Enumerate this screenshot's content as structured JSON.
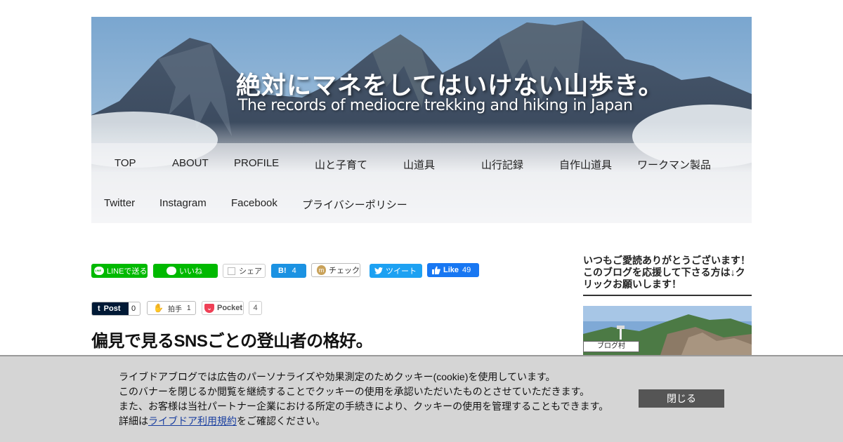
{
  "header": {
    "title": "絶対にマネをしてはいけない山歩き。",
    "subtitle": "The records of mediocre trekking and hiking in Japan"
  },
  "nav": {
    "row1": [
      "TOP",
      "ABOUT",
      "PROFILE",
      "山と子育て",
      "山道具",
      "山行記録",
      "自作山道具",
      "ワークマン製品"
    ],
    "row2": [
      "Twitter",
      "Instagram",
      "Facebook",
      "プライバシーポリシー"
    ]
  },
  "share": {
    "line_send": "LINEで送る",
    "line_like": "いいね",
    "fb_share": "シェア",
    "hatena_label": "B!",
    "hatena_count": "4",
    "mixi_check": "チェック",
    "mixi_icon": "m",
    "tweet": "ツイート",
    "fb_like": "Like",
    "fb_like_count": "49",
    "tumblr_label": "Post",
    "tumblr_count": "0",
    "hakushu_label": "拍手",
    "hakushu_count": "1",
    "pocket_label": "Pocket",
    "pocket_count": "4",
    "colors": {
      "line": "#00b900",
      "hatena": "#1b92e2",
      "twitter": "#1da1f2",
      "facebook": "#1877f2",
      "tumblr": "#001935",
      "pocket": "#ef4056"
    }
  },
  "article": {
    "title": "偏見で見るSNSごとの登山者の格好。"
  },
  "sidebar": {
    "heading": "いつもご愛読ありがとうございます！このブログを応援して下さる方は↓クリックお願いします！",
    "banner_label": "ブログ村"
  },
  "cookie": {
    "line1": "ライブドアブログでは広告のパーソナライズや効果測定のためクッキー(cookie)を使用しています。",
    "line2": "このバナーを閉じるか閲覧を継続することでクッキーの使用を承認いただいたものとさせていただきます。",
    "line3": "また、お客様は当社パートナー企業における所定の手続きにより、クッキーの使用を管理することもできます。",
    "line4_prefix": "詳細は",
    "line4_link": "ライブドア利用規約",
    "line4_suffix": "をご確認ください。",
    "close_label": "閉じる"
  }
}
